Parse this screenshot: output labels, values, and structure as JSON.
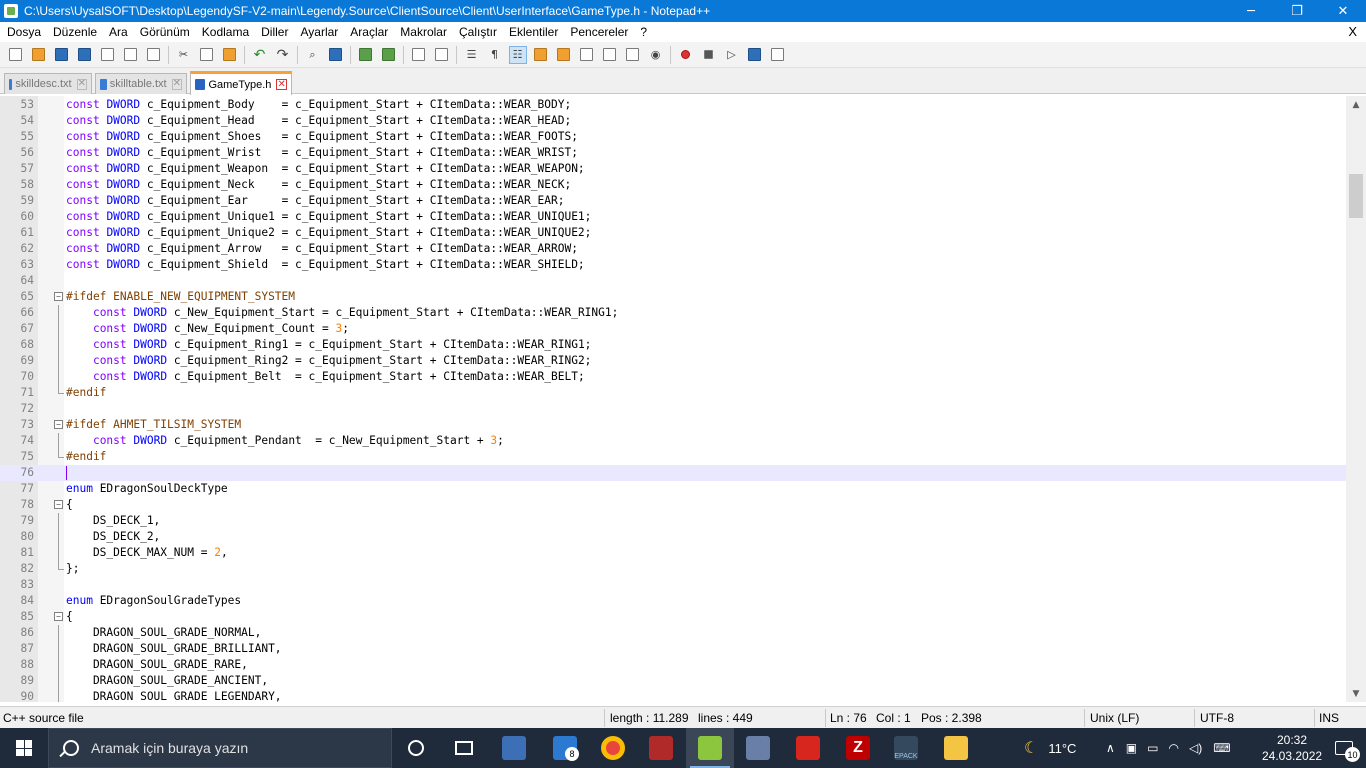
{
  "window": {
    "title": "C:\\Users\\UysalSOFT\\Desktop\\LegendySF-V2-main\\Legendy.Source\\ClientSource\\Client\\UserInterface\\GameType.h - Notepad++",
    "minimize": "─",
    "restore": "❐",
    "close": "✕"
  },
  "menu": {
    "items": [
      "Dosya",
      "Düzenle",
      "Ara",
      "Görünüm",
      "Kodlama",
      "Diller",
      "Ayarlar",
      "Araçlar",
      "Makrolar",
      "Çalıştır",
      "Eklentiler",
      "Pencereler",
      "?"
    ],
    "close_doc": "X"
  },
  "tabs": [
    {
      "label": "skilldesc.txt",
      "active": false
    },
    {
      "label": "skilltable.txt",
      "active": false
    },
    {
      "label": "GameType.h",
      "active": true
    }
  ],
  "editor": {
    "lines": [
      {
        "n": "53",
        "c": "const DWORD c_Equipment_Body    = c_Equipment_Start + CItemData::WEAR_BODY;"
      },
      {
        "n": "54",
        "c": "const DWORD c_Equipment_Head    = c_Equipment_Start + CItemData::WEAR_HEAD;"
      },
      {
        "n": "55",
        "c": "const DWORD c_Equipment_Shoes   = c_Equipment_Start + CItemData::WEAR_FOOTS;"
      },
      {
        "n": "56",
        "c": "const DWORD c_Equipment_Wrist   = c_Equipment_Start + CItemData::WEAR_WRIST;"
      },
      {
        "n": "57",
        "c": "const DWORD c_Equipment_Weapon  = c_Equipment_Start + CItemData::WEAR_WEAPON;"
      },
      {
        "n": "58",
        "c": "const DWORD c_Equipment_Neck    = c_Equipment_Start + CItemData::WEAR_NECK;"
      },
      {
        "n": "59",
        "c": "const DWORD c_Equipment_Ear     = c_Equipment_Start + CItemData::WEAR_EAR;"
      },
      {
        "n": "60",
        "c": "const DWORD c_Equipment_Unique1 = c_Equipment_Start + CItemData::WEAR_UNIQUE1;"
      },
      {
        "n": "61",
        "c": "const DWORD c_Equipment_Unique2 = c_Equipment_Start + CItemData::WEAR_UNIQUE2;"
      },
      {
        "n": "62",
        "c": "const DWORD c_Equipment_Arrow   = c_Equipment_Start + CItemData::WEAR_ARROW;"
      },
      {
        "n": "63",
        "c": "const DWORD c_Equipment_Shield  = c_Equipment_Start + CItemData::WEAR_SHIELD;"
      },
      {
        "n": "64",
        "c": ""
      },
      {
        "n": "65",
        "c": "#ifdef ENABLE_NEW_EQUIPMENT_SYSTEM"
      },
      {
        "n": "66",
        "c": "    const DWORD c_New_Equipment_Start = c_Equipment_Start + CItemData::WEAR_RING1;"
      },
      {
        "n": "67",
        "c": "    const DWORD c_New_Equipment_Count = 3;"
      },
      {
        "n": "68",
        "c": "    const DWORD c_Equipment_Ring1 = c_Equipment_Start + CItemData::WEAR_RING1;"
      },
      {
        "n": "69",
        "c": "    const DWORD c_Equipment_Ring2 = c_Equipment_Start + CItemData::WEAR_RING2;"
      },
      {
        "n": "70",
        "c": "    const DWORD c_Equipment_Belt  = c_Equipment_Start + CItemData::WEAR_BELT;"
      },
      {
        "n": "71",
        "c": "#endif"
      },
      {
        "n": "72",
        "c": ""
      },
      {
        "n": "73",
        "c": "#ifdef AHMET_TILSIM_SYSTEM"
      },
      {
        "n": "74",
        "c": "    const DWORD c_Equipment_Pendant  = c_New_Equipment_Start + 3;"
      },
      {
        "n": "75",
        "c": "#endif"
      },
      {
        "n": "76",
        "c": ""
      },
      {
        "n": "77",
        "c": "enum EDragonSoulDeckType"
      },
      {
        "n": "78",
        "c": "{"
      },
      {
        "n": "79",
        "c": "    DS_DECK_1,"
      },
      {
        "n": "80",
        "c": "    DS_DECK_2,"
      },
      {
        "n": "81",
        "c": "    DS_DECK_MAX_NUM = 2,"
      },
      {
        "n": "82",
        "c": "};"
      },
      {
        "n": "83",
        "c": ""
      },
      {
        "n": "84",
        "c": "enum EDragonSoulGradeTypes"
      },
      {
        "n": "85",
        "c": "{"
      },
      {
        "n": "86",
        "c": "    DRAGON_SOUL_GRADE_NORMAL,"
      },
      {
        "n": "87",
        "c": "    DRAGON_SOUL_GRADE_BRILLIANT,"
      },
      {
        "n": "88",
        "c": "    DRAGON_SOUL_GRADE_RARE,"
      },
      {
        "n": "89",
        "c": "    DRAGON_SOUL_GRADE_ANCIENT,"
      },
      {
        "n": "90",
        "c": "    DRAGON_SOUL_GRADE_LEGENDARY,"
      }
    ],
    "current_line": "76"
  },
  "status": {
    "file_type": "C++ source file",
    "length": "length : 11.289",
    "lines": "lines : 449",
    "ln": "Ln : 76",
    "col": "Col : 1",
    "pos": "Pos : 2.398",
    "eol": "Unix (LF)",
    "encoding": "UTF-8",
    "mode": "INS"
  },
  "taskbar": {
    "search_placeholder": "Aramak için buraya yazın",
    "mail_badge": "8",
    "weather": "11°C",
    "time": "20:32",
    "date": "24.03.2022",
    "notification_count": "10",
    "app_label": "EPACK"
  }
}
